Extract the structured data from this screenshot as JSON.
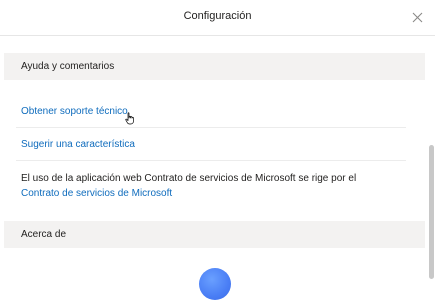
{
  "header": {
    "title": "Configuración"
  },
  "sections": {
    "help": {
      "title": "Ayuda y comentarios",
      "links": {
        "support": "Obtener soporte técnico",
        "suggest": "Sugerir una característica"
      },
      "legal": {
        "text": "El uso de la aplicación web Contrato de servicios de Microsoft se rige por el",
        "link": "Contrato de servicios de Microsoft"
      }
    },
    "about": {
      "title": "Acerca de"
    }
  },
  "icons": {
    "close": "close-icon",
    "cursor": "hand-pointer-icon",
    "avatar": "app-logo-icon"
  },
  "colors": {
    "link": "#0f6cbd",
    "section_bg": "#f3f2f1",
    "avatar": "#4a7ef5"
  }
}
